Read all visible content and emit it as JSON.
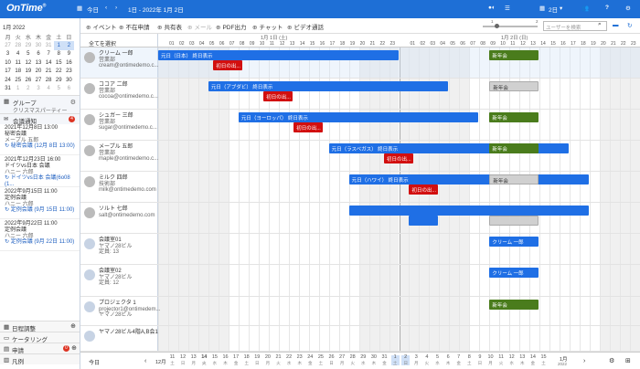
{
  "topbar": {
    "logo": "OnTime",
    "logo_mark": "®",
    "today": "今日",
    "date_range": "1日 - 2022年 1月 2日",
    "days": "2日",
    "color": "#1e6fd6"
  },
  "calendar": {
    "month": "1月 2022",
    "weekdays": [
      "月",
      "火",
      "水",
      "木",
      "金",
      "土",
      "日"
    ],
    "weeks": [
      [
        "27",
        "28",
        "29",
        "30",
        "31",
        "1",
        "2"
      ],
      [
        "3",
        "4",
        "5",
        "6",
        "7",
        "8",
        "9"
      ],
      [
        "10",
        "11",
        "12",
        "13",
        "14",
        "15",
        "16"
      ],
      [
        "17",
        "18",
        "19",
        "20",
        "21",
        "22",
        "23"
      ],
      [
        "24",
        "25",
        "26",
        "27",
        "28",
        "29",
        "30"
      ],
      [
        "31",
        "1",
        "2",
        "3",
        "4",
        "5",
        "6"
      ]
    ]
  },
  "sidebar": {
    "group_label": "グループ",
    "group_name": "クリスマスパーティー",
    "notif_label": "会議通知",
    "notif_count": "4",
    "notifications": [
      {
        "when": "2021年12月8日 13:00",
        "title": "秘密会議",
        "who": "メープル 五郎",
        "item": "秘密会議 (12月 8日 13:00)"
      },
      {
        "when": "2021年12月23日 16:00",
        "title": "ドイツvs日本 会議",
        "who": "ハニー 六郎",
        "item": "ドイツvs日本 会議(6o08 (1..."
      },
      {
        "when": "2022年9月15日 11:00",
        "title": "定例会議",
        "who": "ハニー 六郎",
        "item": "定例会議 (9月 15日 11:00)"
      },
      {
        "when": "2022年9月22日 11:00",
        "title": "定例会議",
        "who": "ハニー 六郎",
        "item": "定例会議 (9月 22日 11:00)"
      }
    ],
    "bottom": [
      {
        "label": "日程調整"
      },
      {
        "label": "ケータリング"
      },
      {
        "label": "申請",
        "badge": "0"
      },
      {
        "label": "凡例"
      }
    ]
  },
  "toolbar": {
    "buttons": [
      "イベント",
      "不在申請",
      "共有表",
      "メール",
      "PDF出力",
      "チャット",
      "ビデオ通話"
    ],
    "search_placeholder": "ユーザーを検索",
    "slider_min": "1",
    "slider_max": "2"
  },
  "grid": {
    "select_all": "全てを選択",
    "day1": "1月 1日 (土)",
    "day2": "1月 2日 (日)",
    "hours": [
      "01",
      "02",
      "03",
      "04",
      "05",
      "06",
      "07",
      "08",
      "09",
      "10",
      "11",
      "12",
      "13",
      "14",
      "15",
      "16",
      "17",
      "18",
      "19",
      "20",
      "21",
      "22",
      "23"
    ],
    "rows": [
      {
        "name": "クリーム 一郎",
        "dept": "営業部",
        "mail": "cream@ontimedemo.c..."
      },
      {
        "name": "ココア 二郎",
        "dept": "営業部",
        "mail": "cocoa@ontimedemo.c..."
      },
      {
        "name": "シュガー 三郎",
        "dept": "営業部",
        "mail": "sugar@ontimedemo.c..."
      },
      {
        "name": "メープル 五郎",
        "dept": "営業部",
        "mail": "maple@ontimedemo.c..."
      },
      {
        "name": "ミルク 四郎",
        "dept": "技術部",
        "mail": "milk@ontimedemo.com"
      },
      {
        "name": "ソルト 七郎",
        "dept": "",
        "mail": "salt@ontimedemo.com"
      },
      {
        "name": "会議室01",
        "dept": "ヤマノ28ビル",
        "mail": "定員: 13"
      },
      {
        "name": "会議室02",
        "dept": "ヤマノ28ビル",
        "mail": "定員: 12"
      },
      {
        "name": "プロジェクタ 1",
        "dept": "projector1@ontimedem...",
        "mail": "ヤマノ28ビル"
      },
      {
        "name": "ヤマノ28ビル4階A,B会1",
        "dept": "",
        "mail": ""
      }
    ],
    "events": {
      "holiday_japan": "元日（日本） 終日表示",
      "holiday_argentina": "元日（アブダビ） 終日表示",
      "holiday_europe": "元日（ヨーロッパ） 終日表示",
      "holiday_vegas": "元日（ラスベガス） 終日表示",
      "holiday_hawaii": "元日（ハワイ） 終日表示",
      "first_sunrise": "初日の出...",
      "new_year_party": "新年会",
      "cream_ichiro": "クリーム 一郎"
    }
  },
  "footer": {
    "today": "今日",
    "dec": "12月",
    "jan": "1月",
    "year": "2022",
    "days": [
      "11",
      "12",
      "13",
      "14",
      "15",
      "16",
      "17",
      "18",
      "19",
      "20",
      "21",
      "22",
      "23",
      "24",
      "25",
      "26",
      "27",
      "28",
      "29",
      "30",
      "31",
      "1",
      "2",
      "3",
      "4",
      "5",
      "6",
      "7",
      "8",
      "9",
      "10",
      "11",
      "12",
      "13",
      "14",
      "15"
    ],
    "dows": [
      "土",
      "日",
      "月",
      "火",
      "水",
      "木",
      "金",
      "土",
      "日",
      "月",
      "火",
      "水",
      "木",
      "金",
      "土",
      "日",
      "月",
      "火",
      "水",
      "木",
      "金",
      "土",
      "日",
      "月",
      "火",
      "水",
      "木",
      "金",
      "土",
      "日",
      "月",
      "火",
      "水",
      "木",
      "金",
      "土"
    ]
  }
}
